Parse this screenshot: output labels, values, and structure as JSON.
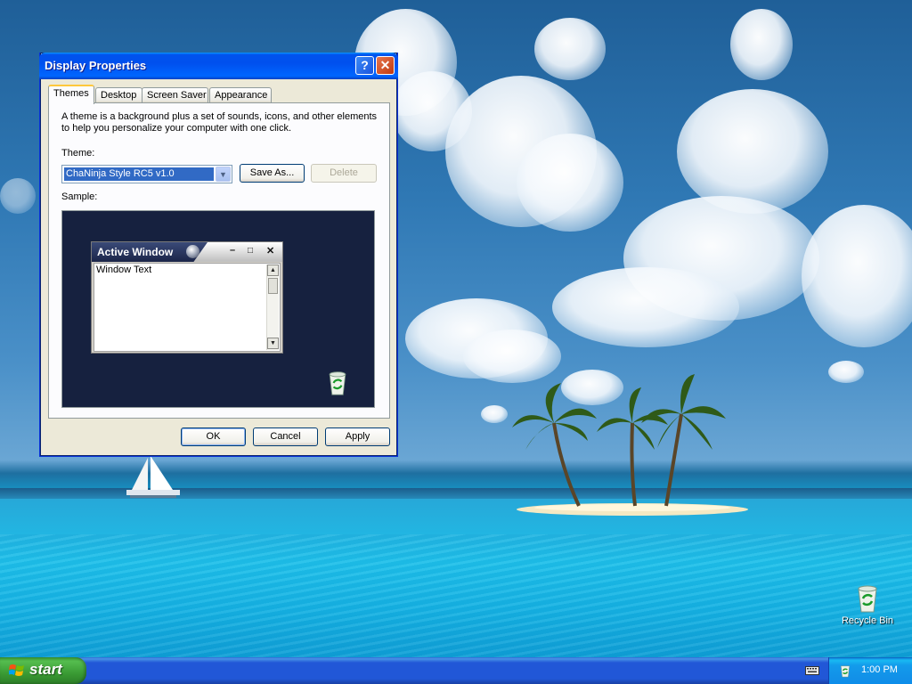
{
  "window": {
    "title": "Display Properties",
    "help_label": "?",
    "close_label": "✕",
    "tabs": [
      {
        "label": "Themes"
      },
      {
        "label": "Desktop"
      },
      {
        "label": "Screen Saver"
      },
      {
        "label": "Appearance"
      }
    ],
    "themes": {
      "description": "A theme is a background plus a set of sounds, icons, and other elements to help you personalize your computer with one click.",
      "theme_label": "Theme:",
      "theme_value": "ChaNinja Style RC5 v1.0",
      "save_as_label": "Save As...",
      "delete_label": "Delete",
      "sample_label": "Sample:",
      "sample": {
        "window_title": "Active Window",
        "window_text": "Window Text"
      }
    },
    "buttons": {
      "ok": "OK",
      "cancel": "Cancel",
      "apply": "Apply"
    }
  },
  "desktop": {
    "icons": [
      {
        "label": "Recycle Bin"
      }
    ]
  },
  "taskbar": {
    "start_label": "start",
    "clock": "1:00 PM"
  }
}
